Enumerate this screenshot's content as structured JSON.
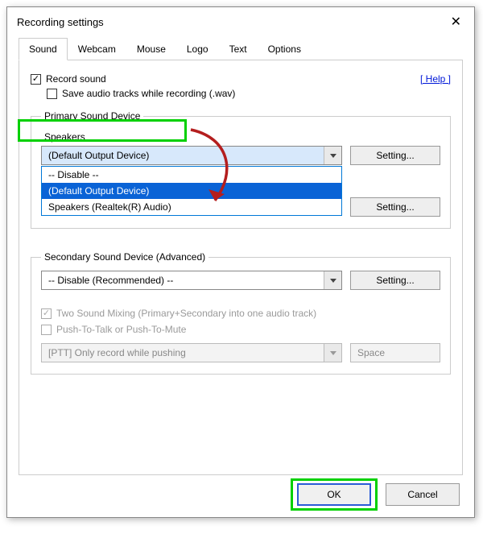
{
  "window_title": "Recording settings",
  "tabs": [
    {
      "label": "Sound",
      "active": true
    },
    {
      "label": "Webcam"
    },
    {
      "label": "Mouse"
    },
    {
      "label": "Logo"
    },
    {
      "label": "Text"
    },
    {
      "label": "Options"
    }
  ],
  "record_sound": {
    "label": "Record sound",
    "checked": true
  },
  "save_audio": {
    "label": "Save audio tracks while recording (.wav)",
    "checked": false
  },
  "help_link": "[ Help ]",
  "primary": {
    "legend": "Primary Sound Device",
    "speakers_label": "Speakers",
    "speakers_value": "(Default Output Device)",
    "dropdown": [
      {
        "label": "-- Disable --",
        "hover": false
      },
      {
        "label": "(Default Output Device)",
        "hover": true
      },
      {
        "label": "Speakers (Realtek(R) Audio)",
        "hover": false
      }
    ],
    "setting_label": "Setting..."
  },
  "secondary": {
    "legend": "Secondary Sound Device (Advanced)",
    "value": "-- Disable (Recommended) --",
    "setting_label": "Setting..."
  },
  "mixing": {
    "two_sound": {
      "label": "Two Sound Mixing (Primary+Secondary into one audio track)",
      "checked": true,
      "disabled": true
    },
    "ptt": {
      "label": "Push-To-Talk or Push-To-Mute",
      "checked": false,
      "disabled": true
    },
    "ptt_mode": "[PTT] Only record while pushing",
    "ptt_key": "Space"
  },
  "buttons": {
    "ok": "OK",
    "cancel": "Cancel"
  }
}
